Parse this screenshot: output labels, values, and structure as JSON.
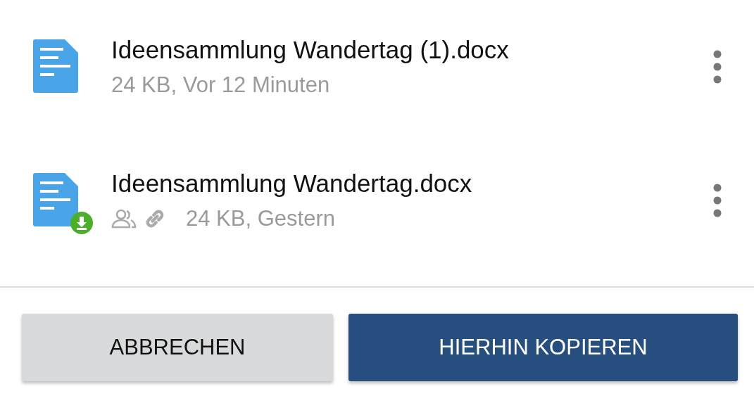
{
  "files": [
    {
      "name": "Ideensammlung Wandertag (1).docx",
      "meta": "24 KB, Vor 12 Minuten",
      "downloaded": false,
      "shared": false,
      "linked": false
    },
    {
      "name": "Ideensammlung Wandertag.docx",
      "meta": "24 KB, Gestern",
      "downloaded": true,
      "shared": true,
      "linked": true
    }
  ],
  "buttons": [
    {
      "label": "ABBRECHEN",
      "kind": "secondary"
    },
    {
      "label": "HIERHIN KOPIEREN",
      "kind": "primary"
    }
  ]
}
